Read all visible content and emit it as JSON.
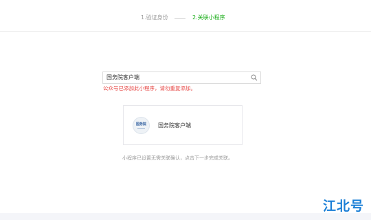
{
  "steps": {
    "step1_label": "1.验证身份",
    "step2_label": "2.关联小程序",
    "active_color": "#1aad19",
    "inactive_color": "#9a9a9a"
  },
  "search": {
    "value": "国务院客户端",
    "icon": "search-icon"
  },
  "error": {
    "message": "公众号已添加此小程序，请勿重复添加。",
    "color": "#e64340"
  },
  "result": {
    "avatar_logo_text": "国务院",
    "name": "国务院客户端"
  },
  "hint": {
    "text": "小程序已设置无需关联确认，点击下一步完成关联。"
  },
  "watermark": {
    "text": "江北号",
    "color": "#1b7fd6"
  }
}
